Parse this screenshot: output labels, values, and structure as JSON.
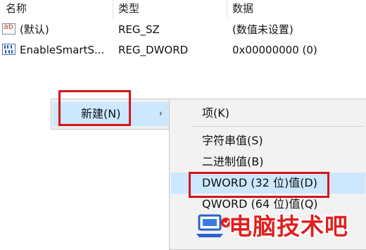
{
  "columns": {
    "name": "名称",
    "type": "类型",
    "data": "数据"
  },
  "rows": [
    {
      "icon": "string-value-icon",
      "name": "(默认)",
      "type": "REG_SZ",
      "data": "(数值未设置)"
    },
    {
      "icon": "binary-value-icon",
      "name": "EnableSmartS...",
      "type": "REG_DWORD",
      "data": "0x00000000 (0)"
    }
  ],
  "context_menu": {
    "new_label": "新建(N)",
    "arrow": "›"
  },
  "submenu": {
    "key": "项(K)",
    "string_value": "字符串值(S)",
    "binary_value": "二进制值(B)",
    "dword_value": "DWORD (32 位)值(D)",
    "qword_value": "QWORD (64 位)值(Q)"
  },
  "colors": {
    "highlight": "#cce8ff",
    "annotation_red": "#d7141a",
    "watermark_red": "#e01f1f"
  },
  "watermark": {
    "text": "电脑技术吧"
  }
}
